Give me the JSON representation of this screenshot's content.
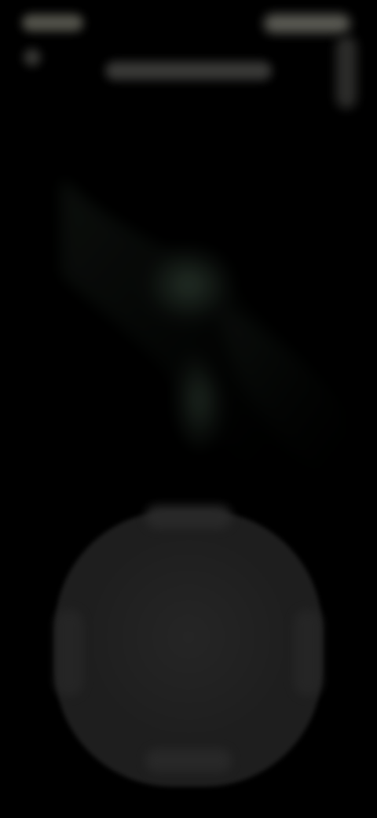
{
  "status_bar": {
    "time": "",
    "right_indicators": ""
  },
  "header": {
    "title": ""
  },
  "viewfinder": {
    "icon": "scene-icon"
  },
  "controls": {
    "capture_label": ""
  },
  "colors": {
    "background": "#000000",
    "capture_pad": "#1e1e1e",
    "accent": "#2a3a2e"
  }
}
